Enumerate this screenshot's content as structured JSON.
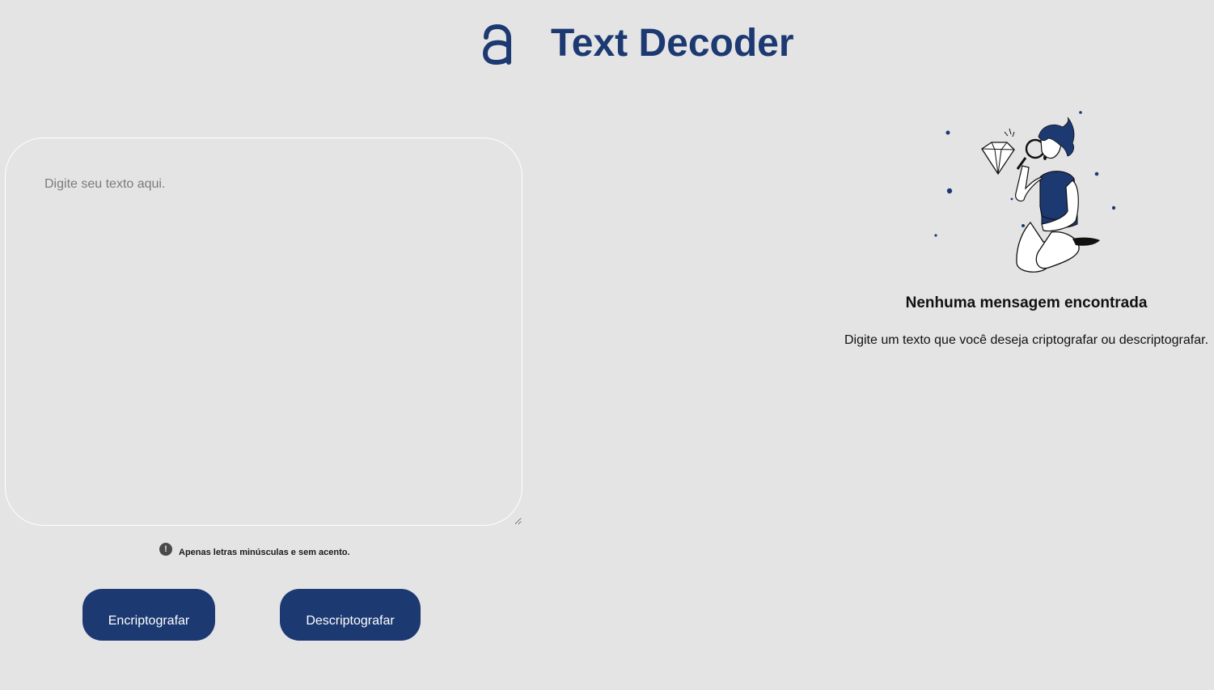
{
  "header": {
    "logo_icon": "alura-logo-icon",
    "title": "Text Decoder"
  },
  "input": {
    "placeholder": "Digite seu texto aqui.",
    "value": ""
  },
  "hint": {
    "icon": "exclamation-circle-icon",
    "icon_glyph": "!",
    "text": "Apenas letras minúsculas e sem acento."
  },
  "buttons": {
    "encrypt_label": "Encriptografar",
    "decrypt_label": "Descriptografar"
  },
  "output": {
    "illustration": "person-with-magnifier-illustration",
    "title": "Nenhuma mensagem encontrada",
    "description": "Digite um texto que você deseja criptografar ou descriptografar."
  },
  "colors": {
    "background": "#e4e4e5",
    "primary": "#1c3972"
  }
}
